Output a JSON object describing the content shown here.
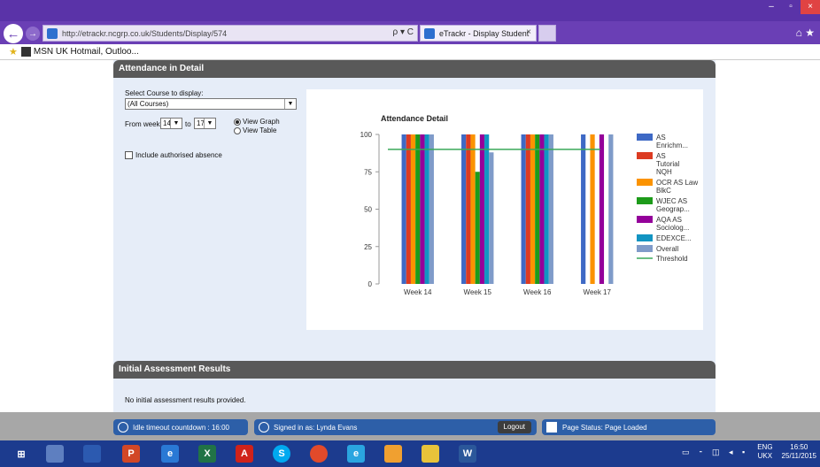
{
  "browser": {
    "url": "http://etrackr.ncgrp.co.uk/Students/Display/574",
    "address_actions": "ρ ▾ C",
    "tab_title": "eTrackr - Display Student",
    "tab_close": "×",
    "favorites_label": "MSN UK Hotmail, Outloo..."
  },
  "attendance": {
    "header": "Attendance in Detail",
    "select_label": "Select Course to display:",
    "course_value": "(All Courses)",
    "from_label": "From week:",
    "from_week": "14",
    "to_label": "to",
    "to_week": "17",
    "view_graph_label": "View Graph",
    "view_table_label": "View Table",
    "selected_view": "graph",
    "include_absence_label": "Include authorised absence",
    "include_absence_checked": false
  },
  "chart_data": {
    "type": "bar",
    "title": "Attendance Detail",
    "xlabel": "",
    "ylabel": "",
    "ylim": [
      0,
      100
    ],
    "yticks": [
      "0",
      "25",
      "50",
      "75",
      "100"
    ],
    "categories": [
      "Week 14",
      "Week 15",
      "Week 16",
      "Week 17"
    ],
    "series": [
      {
        "name": "AS Enrichm...",
        "color": "#3e69c5",
        "values": [
          100,
          100,
          100,
          100
        ]
      },
      {
        "name": "AS Tutorial NQH",
        "color": "#dc3b22",
        "values": [
          100,
          100,
          100,
          0
        ]
      },
      {
        "name": "OCR AS Law BlkC",
        "color": "#fb9300",
        "values": [
          100,
          100,
          100,
          100
        ]
      },
      {
        "name": "WJEC AS Geograp...",
        "color": "#1d9b1a",
        "values": [
          100,
          75,
          100,
          0
        ]
      },
      {
        "name": "AQA AS Sociolog...",
        "color": "#94009a",
        "values": [
          100,
          100,
          100,
          100
        ]
      },
      {
        "name": "EDEXCE...",
        "color": "#1294c2",
        "values": [
          100,
          100,
          100,
          0
        ]
      },
      {
        "name": "Overall",
        "color": "#7f9bc9",
        "values": [
          100,
          88,
          100,
          100
        ]
      }
    ],
    "threshold": {
      "name": "Threshold",
      "color": "#3aa85a",
      "value": 90
    },
    "legend_position": "right"
  },
  "initial_assessment": {
    "header": "Initial Assessment Results",
    "text": "No initial assessment results provided."
  },
  "status": {
    "idle": "Idle timeout countdown : 16:00",
    "signed_in": "Signed in as: Lynda Evans",
    "logout": "Logout",
    "page_status": "Page Status: Page Loaded"
  },
  "taskbar": {
    "apps": [
      "windows-start-icon",
      "file-manager-icon",
      "computer-icon",
      "powerpoint-icon",
      "internet-explorer-icon",
      "excel-icon",
      "pdf-reader-icon",
      "skype-icon",
      "chrome-icon",
      "ie-blue-icon",
      "mail-icon",
      "folder-icon",
      "word-icon"
    ],
    "lang_top": "ENG",
    "lang_bottom": "UKX",
    "time": "16:50",
    "date": "25/11/2015"
  }
}
